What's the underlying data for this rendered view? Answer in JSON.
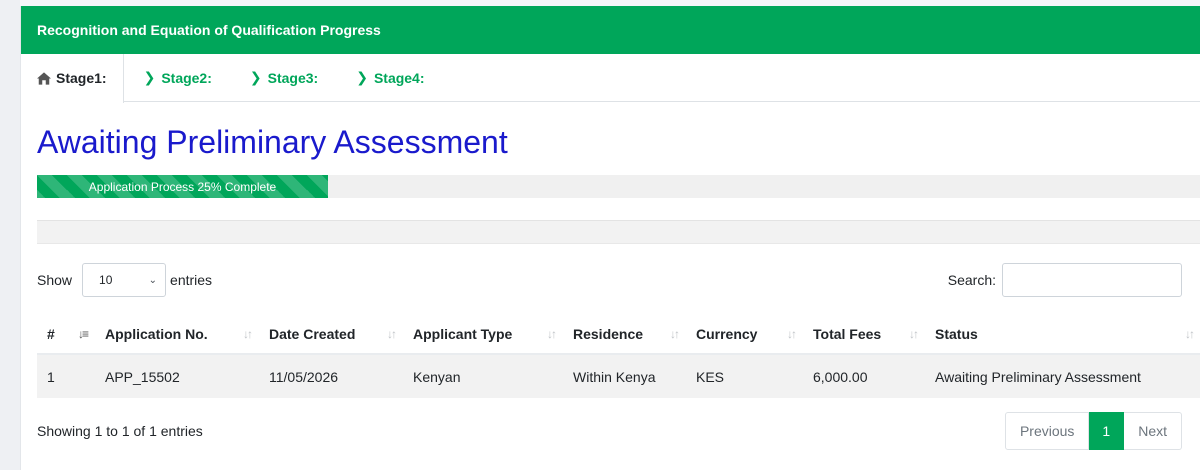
{
  "header": {
    "title": "Recognition and Equation of Qualification Progress"
  },
  "tabs": [
    {
      "label": "Stage1:",
      "icon": "home-icon"
    },
    {
      "label": "Stage2:",
      "icon": "chevron-right-icon"
    },
    {
      "label": "Stage3:",
      "icon": "chevron-right-icon"
    },
    {
      "label": "Stage4:",
      "icon": "chevron-right-icon"
    }
  ],
  "page_title": "Awaiting Preliminary Assessment",
  "progress": {
    "label": "Application Process 25% Complete",
    "percent": 25
  },
  "length_control": {
    "prefix": "Show",
    "value": "10",
    "suffix": "entries"
  },
  "search": {
    "label": "Search:",
    "value": ""
  },
  "table": {
    "columns": [
      "#",
      "Application No.",
      "Date Created",
      "Applicant Type",
      "Residence",
      "Currency",
      "Total Fees",
      "Status"
    ],
    "rows": [
      [
        "1",
        "APP_15502",
        "11/05/2026",
        "Kenyan",
        "Within Kenya",
        "KES",
        "6,000.00",
        "Awaiting Preliminary Assessment"
      ]
    ]
  },
  "footer": {
    "info": "Showing 1 to 1 of 1 entries"
  },
  "pagination": {
    "previous": "Previous",
    "current": "1",
    "next": "Next"
  },
  "colors": {
    "accent": "#00a65a",
    "title": "#1a1acc"
  }
}
